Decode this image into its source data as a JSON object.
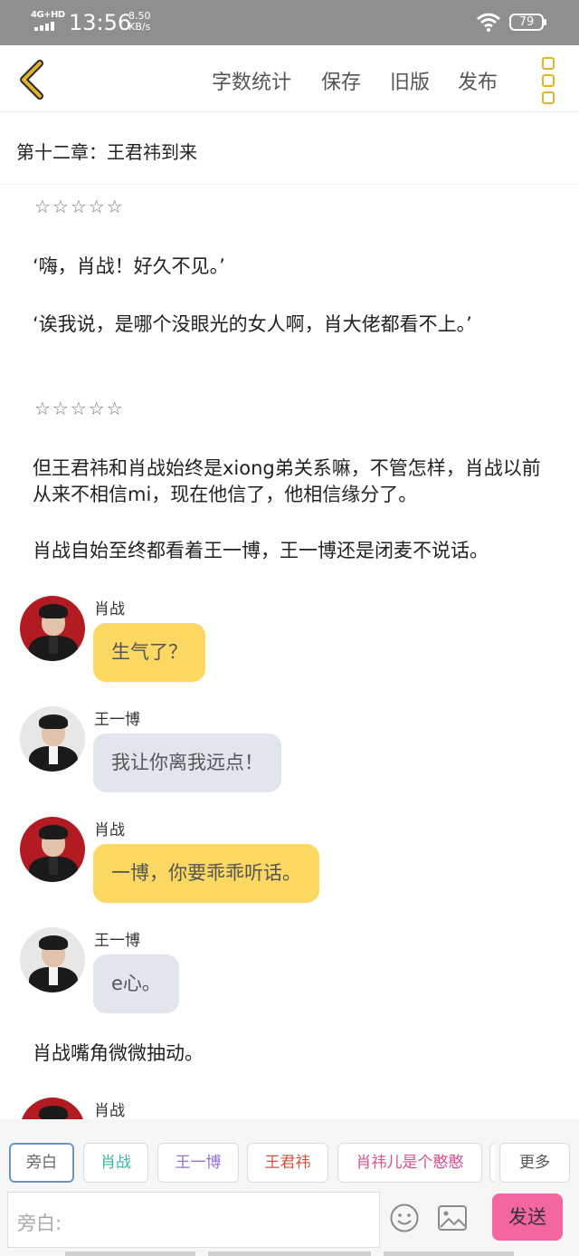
{
  "status_bar": {
    "network": "4G+HD",
    "time": "13:56",
    "speed_value": "8.50",
    "speed_unit": "KB/s",
    "battery": "79"
  },
  "toolbar": {
    "back_icon": "chevron-left-icon",
    "word_count": "字数统计",
    "save": "保存",
    "old_version": "旧版",
    "publish": "发布",
    "more_icon": "kebab-menu-icon",
    "accent": "#e2b526"
  },
  "chapter_title": "第十二章：王君祎到来",
  "content": {
    "stars1": "☆☆☆☆☆",
    "line1": "‘嗨，肖战！好久不见。’",
    "line2": "‘诶我说，是哪个没眼光的女人啊，肖大佬都看不上。’",
    "stars2": "☆☆☆☆☆",
    "para1": "但王君祎和肖战始终是xiong弟关系嘛，不管怎样，肖战以前从来不相信mi，现在他信了，他相信缘分了。",
    "para2": "肖战自始至终都看着王一博，王一博还是闭麦不说话。",
    "para3": "肖战嘴角微微抽动。"
  },
  "messages": [
    {
      "speaker": "肖战",
      "text": "生气了？",
      "style": "yellow"
    },
    {
      "speaker": "王一博",
      "text": "我让你离我远点！",
      "style": "grey"
    },
    {
      "speaker": "肖战",
      "text": "一博，你要乖乖听话。",
      "style": "yellow"
    },
    {
      "speaker": "王一博",
      "text": "e心。",
      "style": "grey"
    },
    {
      "speaker": "肖战"
    }
  ],
  "bottom": {
    "roles": [
      {
        "label": "旁白",
        "color": "#666666"
      },
      {
        "label": "肖战",
        "color": "#3bb5a4"
      },
      {
        "label": "王一博",
        "color": "#9a6fd0"
      },
      {
        "label": "王君祎",
        "color": "#d4503b"
      },
      {
        "label": "肖祎儿是个憨憨",
        "color": "#d6508f"
      }
    ],
    "more": "更多",
    "input_placeholder": "旁白:",
    "emoji_icon": "smiley-icon",
    "image_icon": "image-icon",
    "send": "发送",
    "send_color": "#f466a0"
  }
}
